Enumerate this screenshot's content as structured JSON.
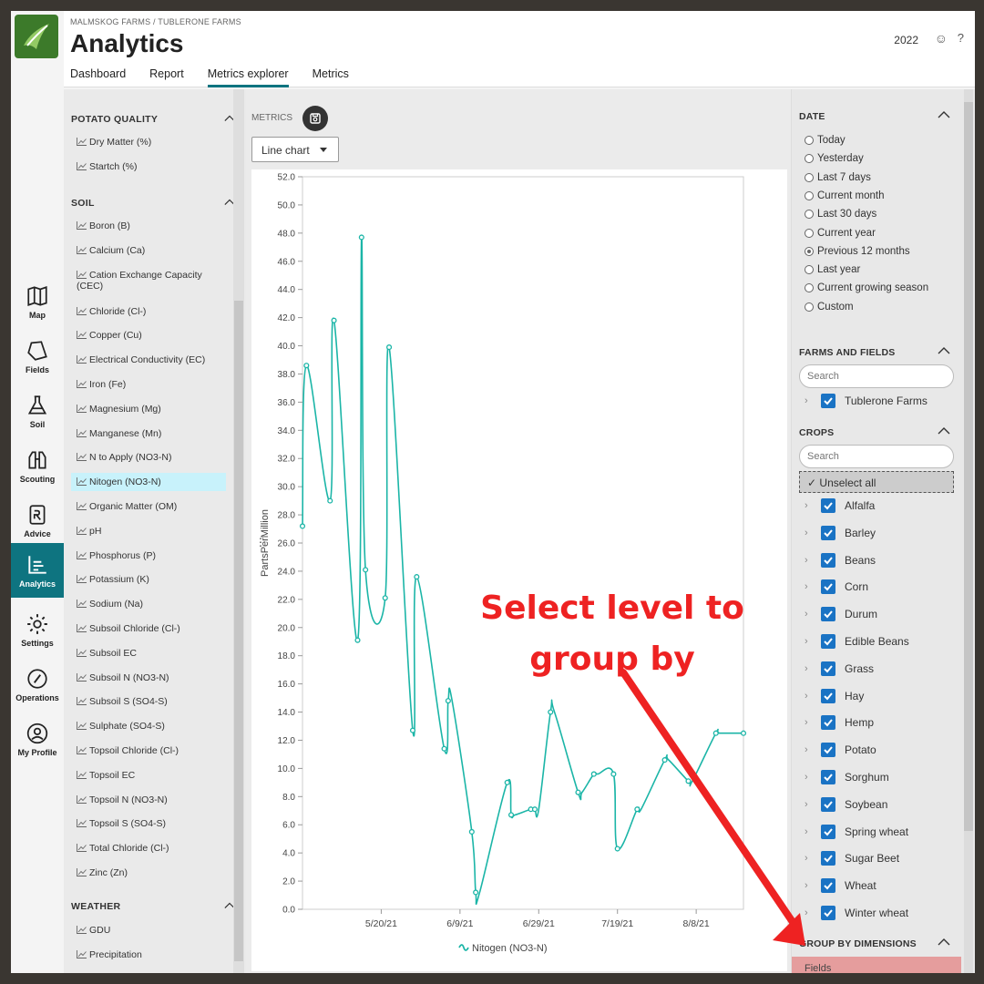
{
  "header": {
    "breadcrumb": "MALMSKOG FARMS / TUBLERONE FARMS",
    "title": "Analytics",
    "year": "2022",
    "help": "?"
  },
  "tabs": [
    "Dashboard",
    "Report",
    "Metrics explorer",
    "Metrics"
  ],
  "nav": [
    "Map",
    "Fields",
    "Soil",
    "Scouting",
    "Advice",
    "Analytics",
    "Settings",
    "Operations",
    "My Profile"
  ],
  "metric_sections": {
    "potato_quality": {
      "title": "POTATO QUALITY",
      "items": [
        "Dry Matter (%)",
        "Startch (%)"
      ]
    },
    "soil": {
      "title": "SOIL",
      "items": [
        "Boron (B)",
        "Calcium (Ca)",
        "Cation Exchange Capacity (CEC)",
        "Chloride (Cl-)",
        "Copper (Cu)",
        "Electrical Conductivity (EC)",
        "Iron (Fe)",
        "Magnesium (Mg)",
        "Manganese (Mn)",
        "N to Apply (NO3-N)",
        "Nitogen (NO3-N)",
        "Organic Matter (OM)",
        "pH",
        "Phosphorus (P)",
        "Potassium (K)",
        "Sodium (Na)",
        "Subsoil Chloride (Cl-)",
        "Subsoil EC",
        "Subsoil N (NO3-N)",
        "Subsoil S (SO4-S)",
        "Sulphate (SO4-S)",
        "Topsoil Chloride (Cl-)",
        "Topsoil EC",
        "Topsoil N (NO3-N)",
        "Topsoil S (SO4-S)",
        "Total Chloride (Cl-)",
        "Zinc (Zn)"
      ]
    },
    "weather": {
      "title": "WEATHER",
      "items": [
        "GDU",
        "Precipitation"
      ]
    }
  },
  "center": {
    "metrics_label": "METRICS",
    "chart_type": "Line chart"
  },
  "chart_data": {
    "type": "line",
    "ylabel": "PartsPerMillion",
    "ylim": [
      0,
      52
    ],
    "yticks": [
      "0.0",
      "2.0",
      "4.0",
      "6.0",
      "8.0",
      "10.0",
      "12.0",
      "14.0",
      "16.0",
      "18.0",
      "20.0",
      "22.0",
      "24.0",
      "26.0",
      "28.0",
      "30.0",
      "32.0",
      "34.0",
      "36.0",
      "38.0",
      "40.0",
      "42.0",
      "44.0",
      "46.0",
      "48.0",
      "50.0",
      "52.0"
    ],
    "xtick_labels": [
      "5/20/21",
      "6/9/21",
      "6/29/21",
      "7/19/21",
      "8/8/21"
    ],
    "xtick_days": [
      20,
      40,
      60,
      80,
      100
    ],
    "x_day_range": [
      0,
      112
    ],
    "series": [
      {
        "name": "Nitogen (NO3-N)",
        "color": "#1bb5a7",
        "x_days": [
          0,
          1,
          7,
          8,
          14,
          15,
          16,
          21,
          22,
          28,
          29,
          36,
          37,
          38,
          43,
          44,
          45,
          52,
          53,
          54,
          58,
          59,
          60,
          63,
          64,
          70,
          71,
          74,
          75,
          79,
          80,
          85,
          86,
          92,
          93,
          98,
          99,
          105,
          106,
          112
        ],
        "values": [
          27.2,
          38.6,
          29.0,
          41.8,
          19.1,
          47.7,
          24.1,
          22.1,
          39.9,
          12.7,
          23.6,
          11.4,
          14.8,
          14.8,
          5.5,
          1.2,
          1.2,
          9.0,
          6.7,
          6.7,
          7.1,
          7.1,
          7.1,
          14.0,
          14.0,
          8.3,
          8.3,
          9.6,
          9.6,
          9.6,
          4.3,
          7.1,
          7.1,
          10.6,
          10.6,
          9.1,
          9.1,
          12.5,
          12.5,
          12.5
        ]
      }
    ],
    "legend": "bottom"
  },
  "filters": {
    "date": {
      "title": "DATE",
      "options": [
        "Today",
        "Yesterday",
        "Last 7 days",
        "Current month",
        "Last 30 days",
        "Current year",
        "Previous 12 months",
        "Last year",
        "Current growing season",
        "Custom"
      ],
      "selected": "Previous 12 months"
    },
    "farms": {
      "title": "FARMS AND FIELDS",
      "search_placeholder": "Search",
      "items": [
        "Tublerone Farms"
      ]
    },
    "crops": {
      "title": "CROPS",
      "search_placeholder": "Search",
      "unselect_label": "Unselect all",
      "items": [
        "Alfalfa",
        "Barley",
        "Beans",
        "Corn",
        "Durum",
        "Edible Beans",
        "Grass",
        "Hay",
        "Hemp",
        "Potato",
        "Sorghum",
        "Soybean",
        "Spring wheat",
        "Sugar Beet",
        "Wheat",
        "Winter wheat"
      ]
    },
    "group": {
      "title": "GROUP BY DIMENSIONS",
      "selected": "Fields"
    }
  },
  "annotation": {
    "line1": "Select level to",
    "line2": "group by",
    "color": "#ee2222"
  }
}
